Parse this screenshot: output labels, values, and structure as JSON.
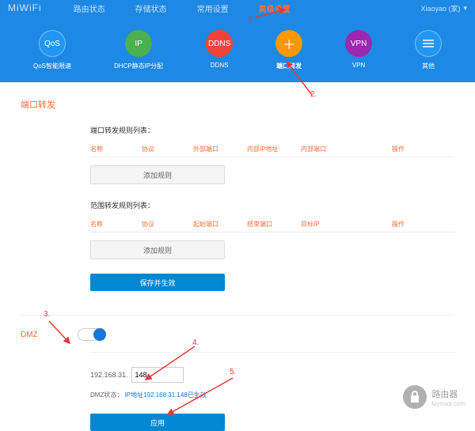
{
  "header": {
    "logo": "MiWiFi",
    "nav": [
      "路由状态",
      "存储状态",
      "常用设置",
      "高级设置"
    ],
    "active_nav_index": 3,
    "user": "Xiaoyao (家)"
  },
  "features": [
    {
      "label": "QoS智能限速",
      "icon": "QoS",
      "color": "c-blue"
    },
    {
      "label": "DHCP静态IP分配",
      "icon": "IP",
      "color": "c-green"
    },
    {
      "label": "DDNS",
      "icon": "DDNS",
      "color": "c-orange"
    },
    {
      "label": "端口转发",
      "icon": "+",
      "color": "c-yellow",
      "active": true
    },
    {
      "label": "VPN",
      "icon": "VPN",
      "color": "c-purple"
    },
    {
      "label": "其他",
      "icon": "≡",
      "color": "c-bluegrey"
    }
  ],
  "page_title": "端口转发",
  "port_forward": {
    "title": "端口转发规则列表：",
    "headers": [
      "名称",
      "协议",
      "外部端口",
      "内部IP地址",
      "内部端口",
      "操作"
    ],
    "add_button": "添加规则"
  },
  "range_forward": {
    "title": "范围转发规则列表：",
    "headers": [
      "名称",
      "协议",
      "起始端口",
      "结束端口",
      "目标IP",
      "操作"
    ],
    "add_button": "添加规则"
  },
  "save_button": "保存并生效",
  "dmz": {
    "label": "DMZ",
    "ip_prefix": "192.168.31.",
    "ip_value": "148",
    "status_label": "DMZ状态：",
    "status_value": "IP地址192.168.31.148已生效",
    "apply_button": "应用"
  },
  "watermark": {
    "title": "路由器",
    "sub": "luyouqi.com"
  },
  "annotations": {
    "a1": "1.",
    "a2": "2.",
    "a3": "3.",
    "a4": "4.",
    "a5": "5."
  }
}
